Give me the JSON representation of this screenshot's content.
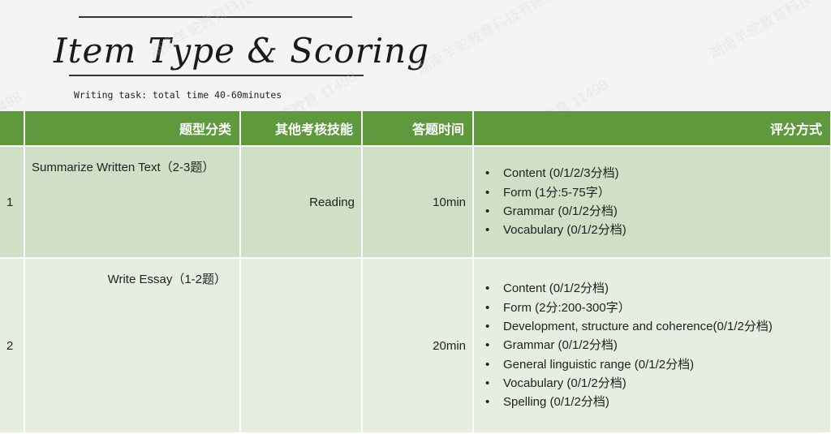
{
  "page": {
    "title": "Item Type & Scoring",
    "subtitle": "Writing task: total time 40-60minutes"
  },
  "table": {
    "headers": [
      "题型分类",
      "其他考核技能",
      "答题时间",
      "评分方式"
    ],
    "rows": [
      {
        "number": "1",
        "type": "Summarize Written Text（2-3题）",
        "skill": "Reading",
        "time": "10min",
        "criteria": [
          "Content (0/1/2/3分档)",
          "Form (1分:5-75字）",
          "Grammar (0/1/2分档)",
          "Vocabulary (0/1/2分档)"
        ]
      },
      {
        "number": "2",
        "type": "Write Essay（1-2题）",
        "skill": "",
        "time": "20min",
        "criteria": [
          "Content (0/1/2分档)",
          "Form (2分:200-300字）",
          "Development, structure and coherence(0/1/2分档)",
          "Grammar (0/1/2分档)",
          "General linguistic range (0/1/2分档)",
          "Vocabulary (0/1/2分档)",
          "Spelling (0/1/2分档)"
        ]
      }
    ]
  },
  "colors": {
    "header_bg": "#5e9a3d",
    "row1_bg": "#cfe0c6",
    "row2_bg": "#e6eee2"
  }
}
